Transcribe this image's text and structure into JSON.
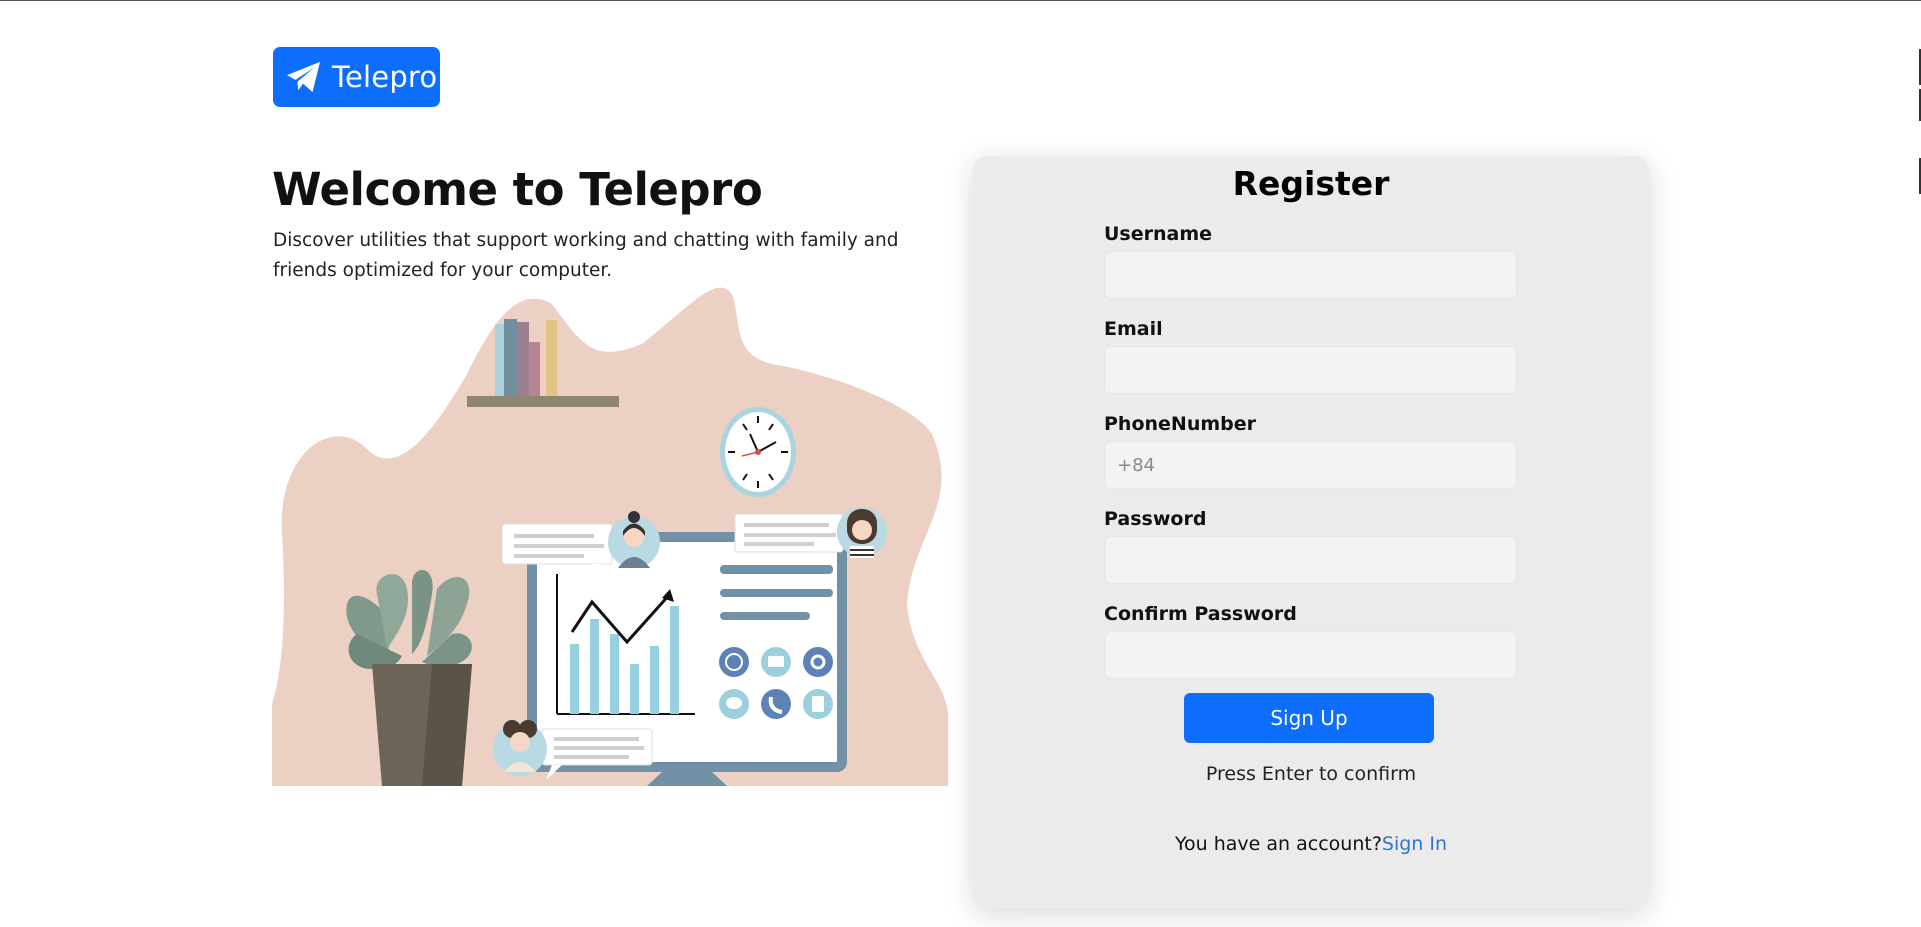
{
  "brand": {
    "name": "Telepro",
    "icon": "paper-plane-icon",
    "color": "#0d6efd"
  },
  "hero": {
    "title": "Welcome to Telepro",
    "description": "Discover utilities that support working and chatting with family and friends optimized for your computer.",
    "illustration": "office-workspace-illustration"
  },
  "register": {
    "title": "Register",
    "fields": [
      {
        "label": "Username",
        "value": "",
        "placeholder": ""
      },
      {
        "label": "Email",
        "value": "",
        "placeholder": ""
      },
      {
        "label": "PhoneNumber",
        "value": "",
        "placeholder": "+84"
      },
      {
        "label": "Password",
        "value": "",
        "placeholder": ""
      },
      {
        "label": "Confirm Password",
        "value": "",
        "placeholder": ""
      }
    ],
    "submit_label": "Sign Up",
    "hint": "Press Enter to confirm",
    "account_prompt": "You have an account?",
    "signin_label": "Sign In"
  },
  "colors": {
    "primary": "#0d6efd",
    "panel_bg": "#ebebeb",
    "link": "#2f74d0",
    "blob": "#ecd0c3"
  }
}
